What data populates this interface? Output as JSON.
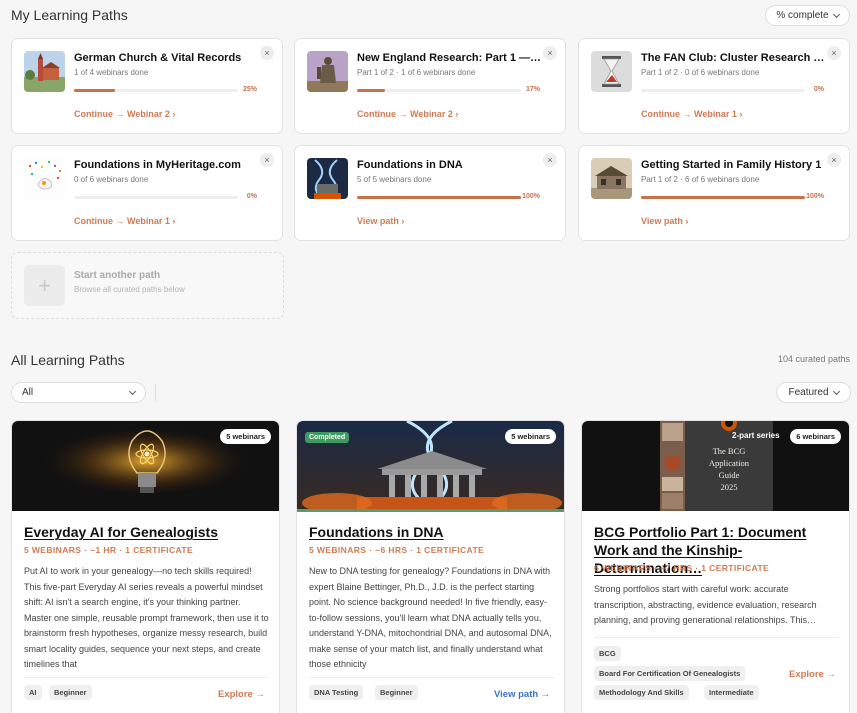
{
  "my_paths": {
    "title": "My Learning Paths",
    "sort_label": "% complete",
    "cards": [
      {
        "title": "German Church & Vital Records",
        "sub": "1 of 4 webinars done",
        "progress": 25,
        "pct": "25%",
        "action": "Continue → Webinar 2",
        "close": "×"
      },
      {
        "title": "New England Research: Part 1 — …",
        "sub": "Part 1 of 2 · 1 of 6 webinars done",
        "progress": 17,
        "pct": "17%",
        "action": "Continue → Webinar 2",
        "close": "×"
      },
      {
        "title": "The FAN Club: Cluster Research …",
        "sub": "Part 1 of 2 · 0 of 6 webinars done",
        "progress": 0,
        "pct": "0%",
        "action": "Continue → Webinar 1",
        "close": "×"
      },
      {
        "title": "Foundations in MyHeritage.com",
        "sub": "0 of 6 webinars done",
        "progress": 0,
        "pct": "0%",
        "action": "Continue → Webinar 1",
        "close": "×"
      },
      {
        "title": "Foundations in DNA",
        "sub": "5 of 5 webinars done",
        "progress": 100,
        "pct": "100%",
        "action": "View path",
        "close": "×"
      },
      {
        "title": "Getting Started in Family History 1",
        "sub": "Part 1 of 2 · 6 of 6 webinars done",
        "progress": 100,
        "pct": "100%",
        "action": "View path",
        "close": "×"
      }
    ],
    "start": {
      "title": "Start another path",
      "sub": "Browse all curated paths below",
      "plus": "+"
    }
  },
  "all_paths": {
    "title": "All Learning Paths",
    "count": "104 curated paths",
    "filter_value": "All",
    "sort_value": "Featured",
    "cards": [
      {
        "badge": "5 webinars",
        "title": "Everyday AI for Genealogists",
        "meta": "5 WEBINARS · ~1 HR · 1 CERTIFICATE",
        "desc": "Put AI to work in your genealogy—no tech skills required! This five-part Everyday AI series reveals a powerful mindset shift: AI isn't a search engine, it's your thinking partner. Master one simple, reusable prompt framework, then use it to brainstorm fresh hypotheses, organize messy research, build smart locality guides, sequence your next steps, and create timelines that",
        "tags": [
          "AI",
          "Beginner"
        ],
        "action": "Explore →"
      },
      {
        "completed": "Completed",
        "badge": "5 webinars",
        "title": "Foundations in DNA",
        "meta": "5 WEBINARS · ~6 HRS · 1 CERTIFICATE",
        "desc": "New to DNA testing for genealogy? Foundations in DNA with expert Blaine Bettinger, Ph.D., J.D. is the perfect starting point. No science background needed! In five friendly, easy-to-follow sessions, you'll learn what DNA actually tells you, understand Y-DNA, mitochondrial DNA, and autosomal DNA, make sense of your match list, and finally understand what those ethnicity",
        "tags": [
          "DNA Testing",
          "Beginner"
        ],
        "action": "View path →"
      },
      {
        "part": "2-part series",
        "badge": "6 webinars",
        "title": "BCG Portfolio Part 1: Document Work and the Kinship-Determination…",
        "meta": "6 WEBINARS · ~7 HRS · 1 CERTIFICATE",
        "desc": "Strong portfolios start with careful work: accurate transcription, abstracting, evidence evaluation, research planning, and proving generational relationships. This…",
        "tags": [
          "BCG",
          "Board For Certification Of Genealogists",
          "Methodology And Skills",
          "Intermediate"
        ],
        "action": "Explore →",
        "cover": {
          "l1": "The BCG",
          "l2": "Application",
          "l3": "Guide",
          "l4": "2025"
        }
      }
    ]
  }
}
